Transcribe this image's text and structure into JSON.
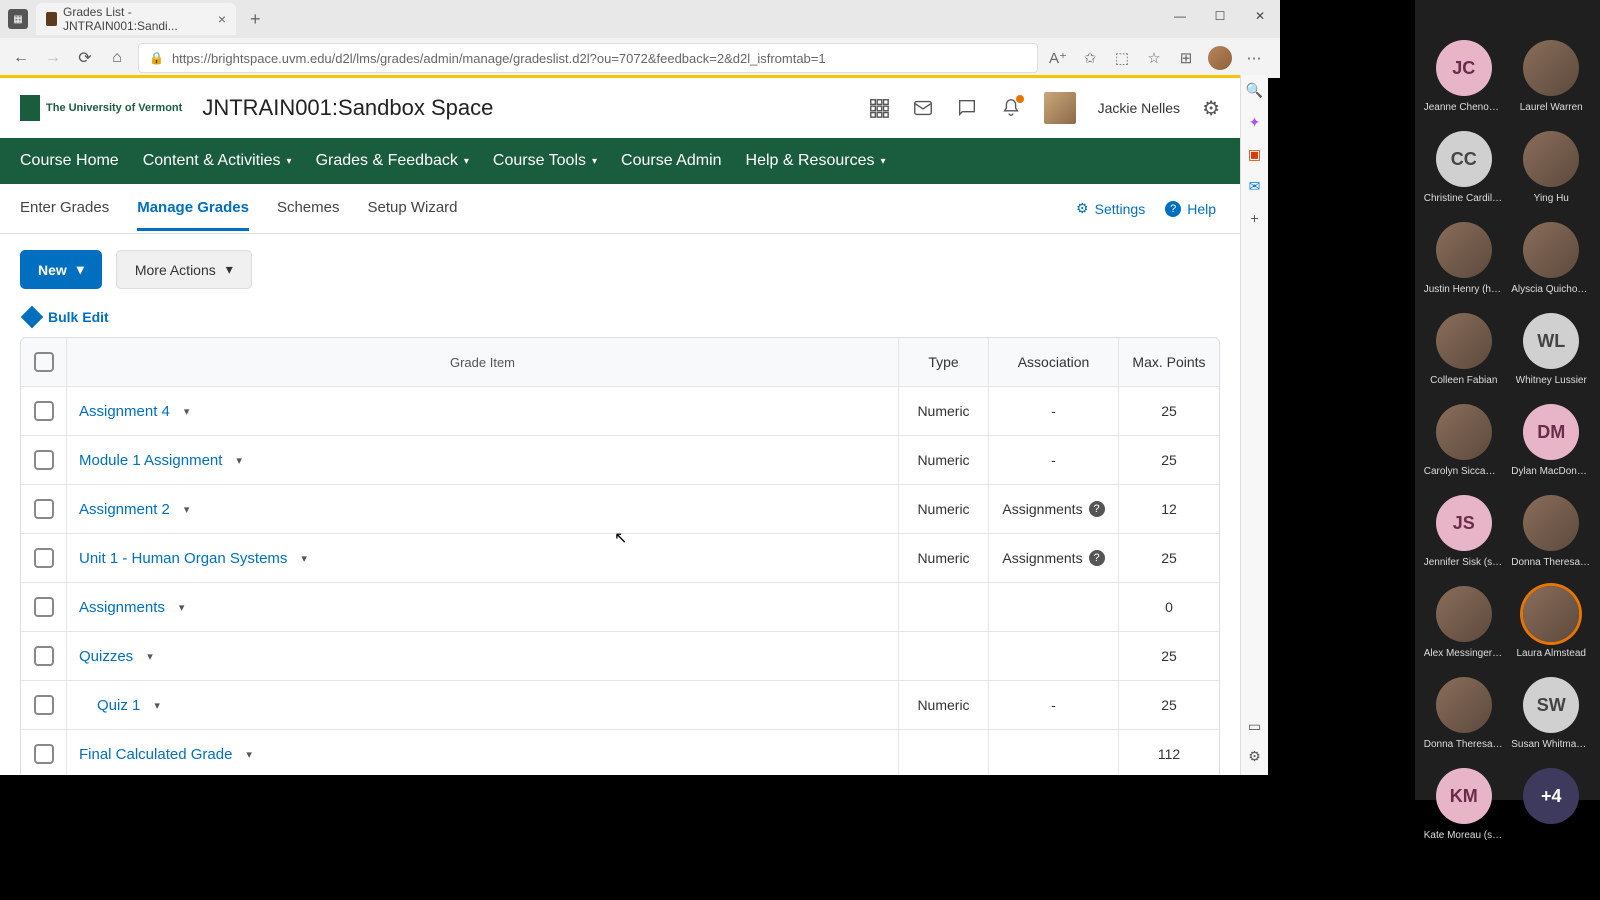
{
  "browser": {
    "tab_title": "Grades List - JNTRAIN001:Sandi...",
    "url": "https://brightspace.uvm.edu/d2l/lms/grades/admin/manage/gradeslist.d2l?ou=7072&feedback=2&d2l_isfromtab=1"
  },
  "header": {
    "logo_text": "The University of Vermont",
    "course_title": "JNTRAIN001:Sandbox Space",
    "user_name": "Jackie Nelles"
  },
  "nav": {
    "items": [
      "Course Home",
      "Content & Activities",
      "Grades & Feedback",
      "Course Tools",
      "Course Admin",
      "Help & Resources"
    ],
    "has_dropdown": [
      false,
      true,
      true,
      true,
      false,
      true
    ]
  },
  "subtabs": {
    "items": [
      "Enter Grades",
      "Manage Grades",
      "Schemes",
      "Setup Wizard"
    ],
    "active_index": 1,
    "settings_label": "Settings",
    "help_label": "Help"
  },
  "toolbar": {
    "new_label": "New",
    "more_actions_label": "More Actions",
    "bulk_edit_label": "Bulk Edit"
  },
  "table": {
    "headers": {
      "item": "Grade Item",
      "type": "Type",
      "assoc": "Association",
      "points": "Max. Points"
    },
    "rows": [
      {
        "name": "Assignment 4",
        "type": "Numeric",
        "assoc": "-",
        "points": "25",
        "indent": false
      },
      {
        "name": "Module 1 Assignment",
        "type": "Numeric",
        "assoc": "-",
        "points": "25",
        "indent": false
      },
      {
        "name": "Assignment 2",
        "type": "Numeric",
        "assoc": "Assignments",
        "assoc_help": true,
        "points": "12",
        "indent": false
      },
      {
        "name": "Unit 1 - Human Organ Systems",
        "type": "Numeric",
        "assoc": "Assignments",
        "assoc_help": true,
        "points": "25",
        "indent": false
      },
      {
        "name": "Assignments",
        "type": "",
        "assoc": "",
        "points": "0",
        "indent": false
      },
      {
        "name": "Quizzes",
        "type": "",
        "assoc": "",
        "points": "25",
        "indent": false
      },
      {
        "name": "Quiz 1",
        "type": "Numeric",
        "assoc": "-",
        "points": "25",
        "indent": true
      },
      {
        "name": "Final Calculated Grade",
        "type": "",
        "assoc": "",
        "points": "112",
        "indent": false
      }
    ]
  },
  "participants": [
    {
      "name": "Jeanne Chenoweth",
      "initials": "JC",
      "style": "pink"
    },
    {
      "name": "Laurel Warren",
      "initials": "",
      "style": "img"
    },
    {
      "name": "Christine Cardillo...",
      "initials": "CC",
      "style": "gray"
    },
    {
      "name": "Ying Hu",
      "initials": "",
      "style": "img"
    },
    {
      "name": "Justin Henry (he/...",
      "initials": "",
      "style": "img"
    },
    {
      "name": "Alyscia Quichocho",
      "initials": "",
      "style": "img"
    },
    {
      "name": "Colleen Fabian",
      "initials": "",
      "style": "img"
    },
    {
      "name": "Whitney Lussier",
      "initials": "WL",
      "style": "gray"
    },
    {
      "name": "Carolyn Siccama (...",
      "initials": "",
      "style": "img"
    },
    {
      "name": "Dylan MacDonald...",
      "initials": "DM",
      "style": "pink"
    },
    {
      "name": "Jennifer Sisk (she...",
      "initials": "JS",
      "style": "pink"
    },
    {
      "name": "Donna Theresa H...",
      "initials": "",
      "style": "img"
    },
    {
      "name": "Alex Messinger (h...",
      "initials": "",
      "style": "img"
    },
    {
      "name": "Laura Almstead",
      "initials": "",
      "style": "img",
      "ring": true
    },
    {
      "name": "Donna Theresa H...",
      "initials": "",
      "style": "img"
    },
    {
      "name": "Susan Whitman (...",
      "initials": "SW",
      "style": "gray"
    },
    {
      "name": "Kate Moreau (she...",
      "initials": "KM",
      "style": "pink"
    },
    {
      "name": "",
      "initials": "+4",
      "style": "darkblue"
    }
  ]
}
